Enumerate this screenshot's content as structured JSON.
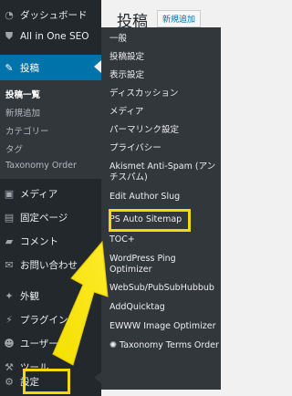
{
  "sidebar": {
    "items": [
      {
        "label": "ダッシュボード",
        "icon": "dashboard-icon"
      },
      {
        "label": "All in One SEO",
        "icon": "seo-icon"
      },
      {
        "label": "投稿",
        "icon": "pin-icon"
      },
      {
        "label": "メディア",
        "icon": "media-icon"
      },
      {
        "label": "固定ページ",
        "icon": "page-icon"
      },
      {
        "label": "コメント",
        "icon": "comment-icon"
      },
      {
        "label": "お問い合わせ",
        "icon": "mail-icon"
      },
      {
        "label": "外観",
        "icon": "appearance-icon"
      },
      {
        "label": "プラグイン",
        "icon": "plugin-icon"
      },
      {
        "label": "ユーザー",
        "icon": "user-icon"
      },
      {
        "label": "ツール",
        "icon": "tool-icon"
      },
      {
        "label": "設定",
        "icon": "settings-icon"
      }
    ],
    "posts_submenu": [
      "投稿一覧",
      "新規追加",
      "カテゴリー",
      "タグ",
      "Taxonomy Order"
    ]
  },
  "main": {
    "title": "投稿",
    "add_new": "新規追加"
  },
  "flyout": {
    "items": [
      "一般",
      "投稿設定",
      "表示設定",
      "ディスカッション",
      "メディア",
      "パーマリンク設定",
      "プライバシー",
      "Akismet Anti-Spam (アンチスパム)",
      "Edit Author Slug",
      "PS Auto Sitemap",
      "TOC+",
      "WordPress Ping Optimizer",
      "WebSub/PubSubHubbub",
      "AddQuicktag",
      "EWWW Image Optimizer",
      "Taxonomy Terms Order"
    ]
  },
  "colors": {
    "sidebar": "#23282d",
    "active": "#0073aa",
    "flyout": "#32373c",
    "highlight": "#f5d90a"
  }
}
